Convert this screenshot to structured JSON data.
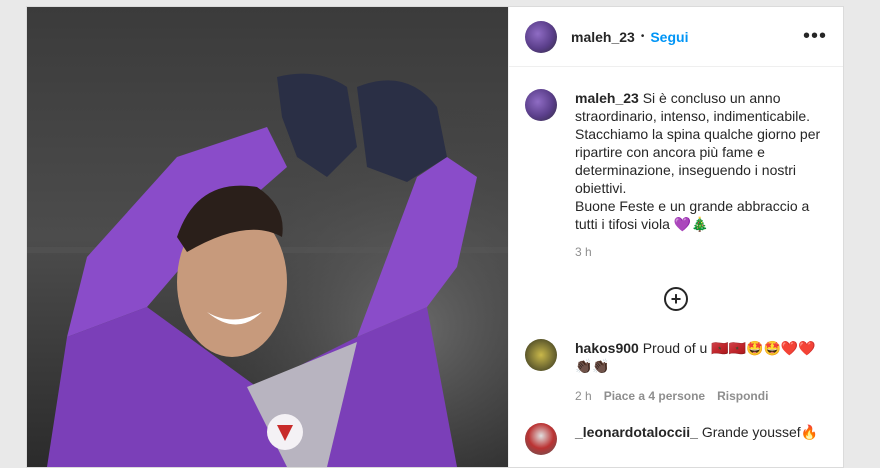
{
  "header": {
    "username": "maleh_23",
    "separator": "•",
    "follow_label": "Segui",
    "more_label": "•••"
  },
  "caption": {
    "username": "maleh_23",
    "lines": [
      "Si è concluso un anno straordinario, intenso, indimenticabile.",
      "Stacchiamo la spina qualche giorno per ripartire con ancora più fame e determinazione, inseguendo i nostri obiettivi.",
      "Buone Feste e un grande abbraccio a tutti i tifosi viola 💜🎄"
    ],
    "time": "3 h"
  },
  "load_more_label": "+",
  "comments": [
    {
      "username": "hakos900",
      "text": "Proud of u 🇲🇦🇲🇦🤩🤩❤️❤️ 👏🏿👏🏿",
      "time": "2 h",
      "likes": "Piace a 4 persone",
      "reply": "Rispondi"
    },
    {
      "username": "_leonardotaloccii_",
      "text": "Grande youssef🔥"
    }
  ],
  "colors": {
    "follow": "#0095f6",
    "jersey": "#7b3fb8",
    "background": "#e9e9e9"
  }
}
